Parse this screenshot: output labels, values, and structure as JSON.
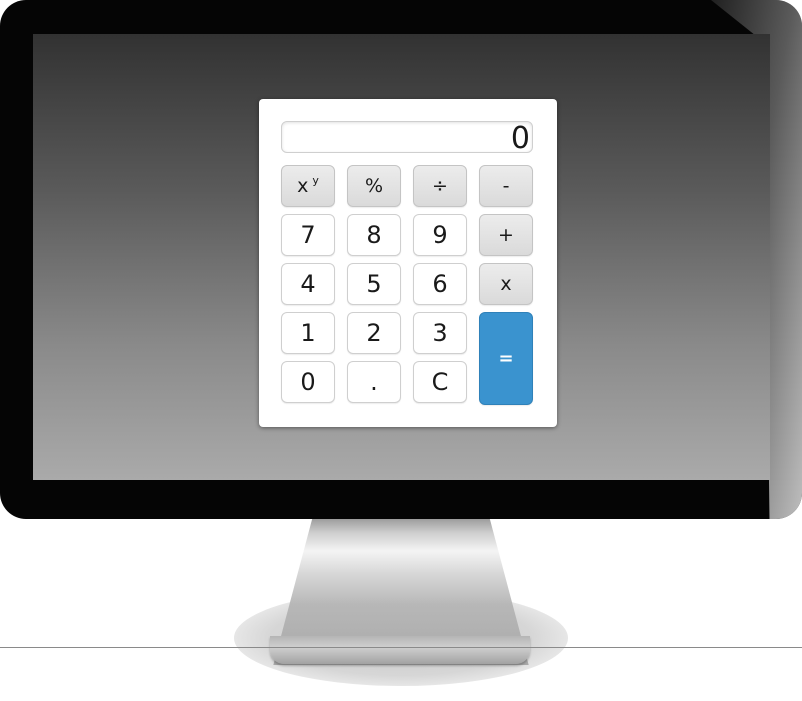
{
  "calculator": {
    "display_value": "0",
    "keys": {
      "power_base": "x",
      "power_exp": "y",
      "percent": "%",
      "divide": "÷",
      "minus": "-",
      "seven": "7",
      "eight": "8",
      "nine": "9",
      "plus": "+",
      "four": "4",
      "five": "5",
      "six": "6",
      "multiply": "x",
      "one": "1",
      "two": "2",
      "three": "3",
      "equals": "=",
      "zero": "0",
      "decimal": ".",
      "clear": "C"
    }
  },
  "colors": {
    "equals_button": "#3a93cf",
    "operator_button": "#e3e3e3",
    "screen_top": "#323232",
    "screen_bottom": "#aaaaaa"
  }
}
